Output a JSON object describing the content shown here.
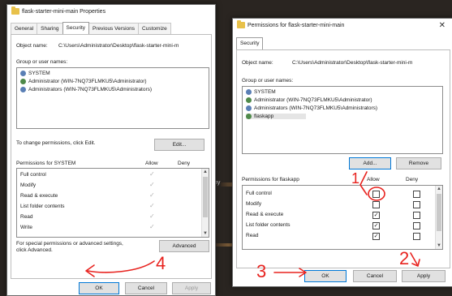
{
  "background_fragment": "my",
  "left_window": {
    "title": "flask-starter-mini-main Properties",
    "tabs": [
      "General",
      "Sharing",
      "Security",
      "Previous Versions",
      "Customize"
    ],
    "active_tab": "Security",
    "object_name_label": "Object name:",
    "object_name_value": "C:\\Users\\Administrator\\Desktop\\flask-starter-mini-m",
    "group_label": "Group or user names:",
    "users": [
      "SYSTEM",
      "Administrator (WIN-7NQ73FLMKU5\\Administrator)",
      "Administrators (WIN-7NQ73FLMKU5\\Administrators)"
    ],
    "change_perms_text": "To change permissions, click Edit.",
    "edit_button": "Edit...",
    "perms_for_label": "Permissions for SYSTEM",
    "allow_label": "Allow",
    "deny_label": "Deny",
    "permissions": [
      "Full control",
      "Modify",
      "Read & execute",
      "List folder contents",
      "Read",
      "Write"
    ],
    "special_text_1": "For special permissions or advanced settings,",
    "special_text_2": "click Advanced.",
    "advanced_button": "Advanced",
    "ok_button": "OK",
    "cancel_button": "Cancel",
    "apply_button": "Apply"
  },
  "right_window": {
    "title": "Permissions for flask-starter-mini-main",
    "close": "✕",
    "tab": "Security",
    "object_name_label": "Object name:",
    "object_name_value": "C:\\Users\\Administrator\\Desktop\\flask-starter-mini-m",
    "group_label": "Group or user names:",
    "users": [
      "SYSTEM",
      "Administrator (WIN-7NQ73FLMKU5\\Administrator)",
      "Administrators (WIN-7NQ73FLMKU5\\Administrators)",
      "flaskapp"
    ],
    "add_button": "Add...",
    "remove_button": "Remove",
    "perms_for_label": "Permissions for flaskapp",
    "allow_label": "Allow",
    "deny_label": "Deny",
    "permissions": [
      "Full control",
      "Modify",
      "Read & execute",
      "List folder contents",
      "Read"
    ],
    "allow_checked": [
      false,
      false,
      true,
      true,
      true
    ],
    "ok_button": "OK",
    "cancel_button": "Cancel",
    "apply_button": "Apply"
  },
  "annotations": {
    "label_4": "4",
    "label_1": "1",
    "label_3": "3",
    "label_2": "2",
    "color": "#e8231f"
  }
}
